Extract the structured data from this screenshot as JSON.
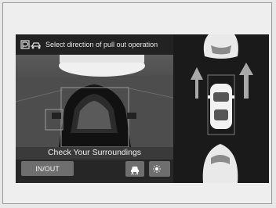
{
  "header": {
    "icon": "park-assist-icon",
    "title": "Select direction of pull out operation"
  },
  "camera": {
    "message": "Check Your Surroundings"
  },
  "controls": {
    "inout_label": "IN/OUT",
    "view_button_icon": "camera-view-icon",
    "brightness_button_icon": "day-night-icon"
  },
  "overhead": {
    "direction_arrows": [
      "forward-left-arrow-icon",
      "forward-right-arrow-icon"
    ],
    "vehicle_icon": "car-top-view-icon"
  },
  "colors": {
    "screen_bg": "#101010",
    "button_bg": "#6e6e6e",
    "text": "#f0f0f0"
  }
}
